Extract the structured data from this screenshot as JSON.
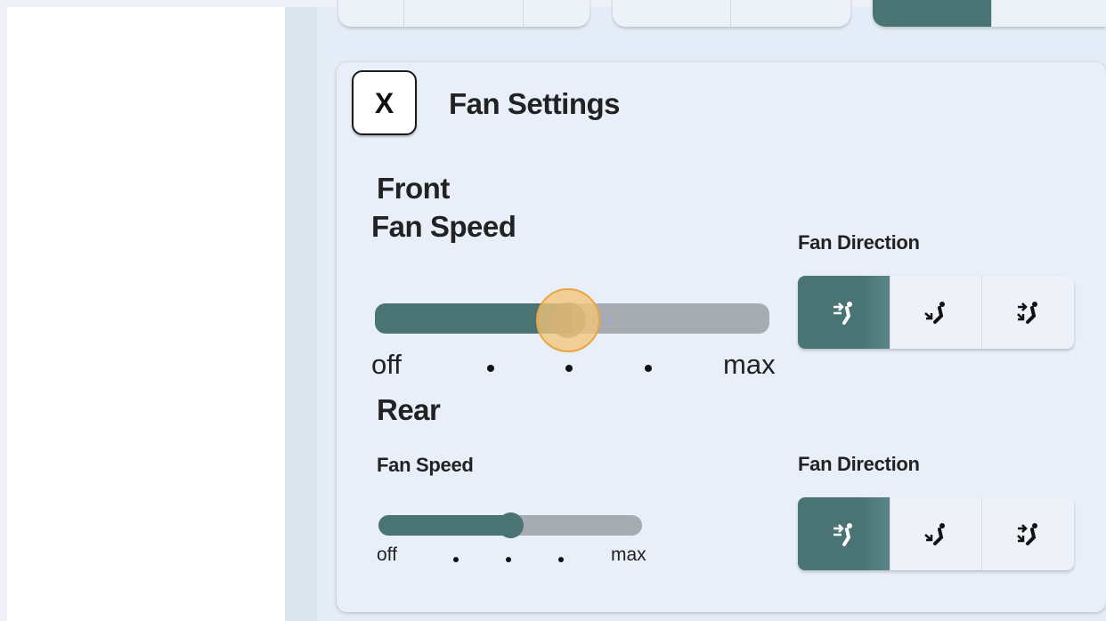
{
  "top_cards": {
    "card1_segments": 3,
    "card2_segments": 2,
    "card3_active": true
  },
  "panel": {
    "title": "Fan Settings",
    "close_label": "X"
  },
  "front": {
    "heading_line1": "Front",
    "heading_line2": "Fan Speed",
    "speed_level": 0.5,
    "scale_min": "off",
    "scale_max": "max",
    "direction_label": "Fan Direction",
    "selected_direction": "face"
  },
  "rear": {
    "heading": "Rear",
    "speed_label": "Fan Speed",
    "speed_level": 0.5,
    "scale_min": "off",
    "scale_max": "max",
    "direction_label": "Fan Direction",
    "selected_direction": "face"
  },
  "directions": [
    {
      "id": "face",
      "icon": "airflow-face-icon"
    },
    {
      "id": "feet",
      "icon": "airflow-feet-icon"
    },
    {
      "id": "face-feet",
      "icon": "airflow-face-feet-icon"
    }
  ],
  "colors": {
    "accent": "#4a7474",
    "track": "#a7acb2",
    "thumb_highlight": "#f2c478"
  }
}
